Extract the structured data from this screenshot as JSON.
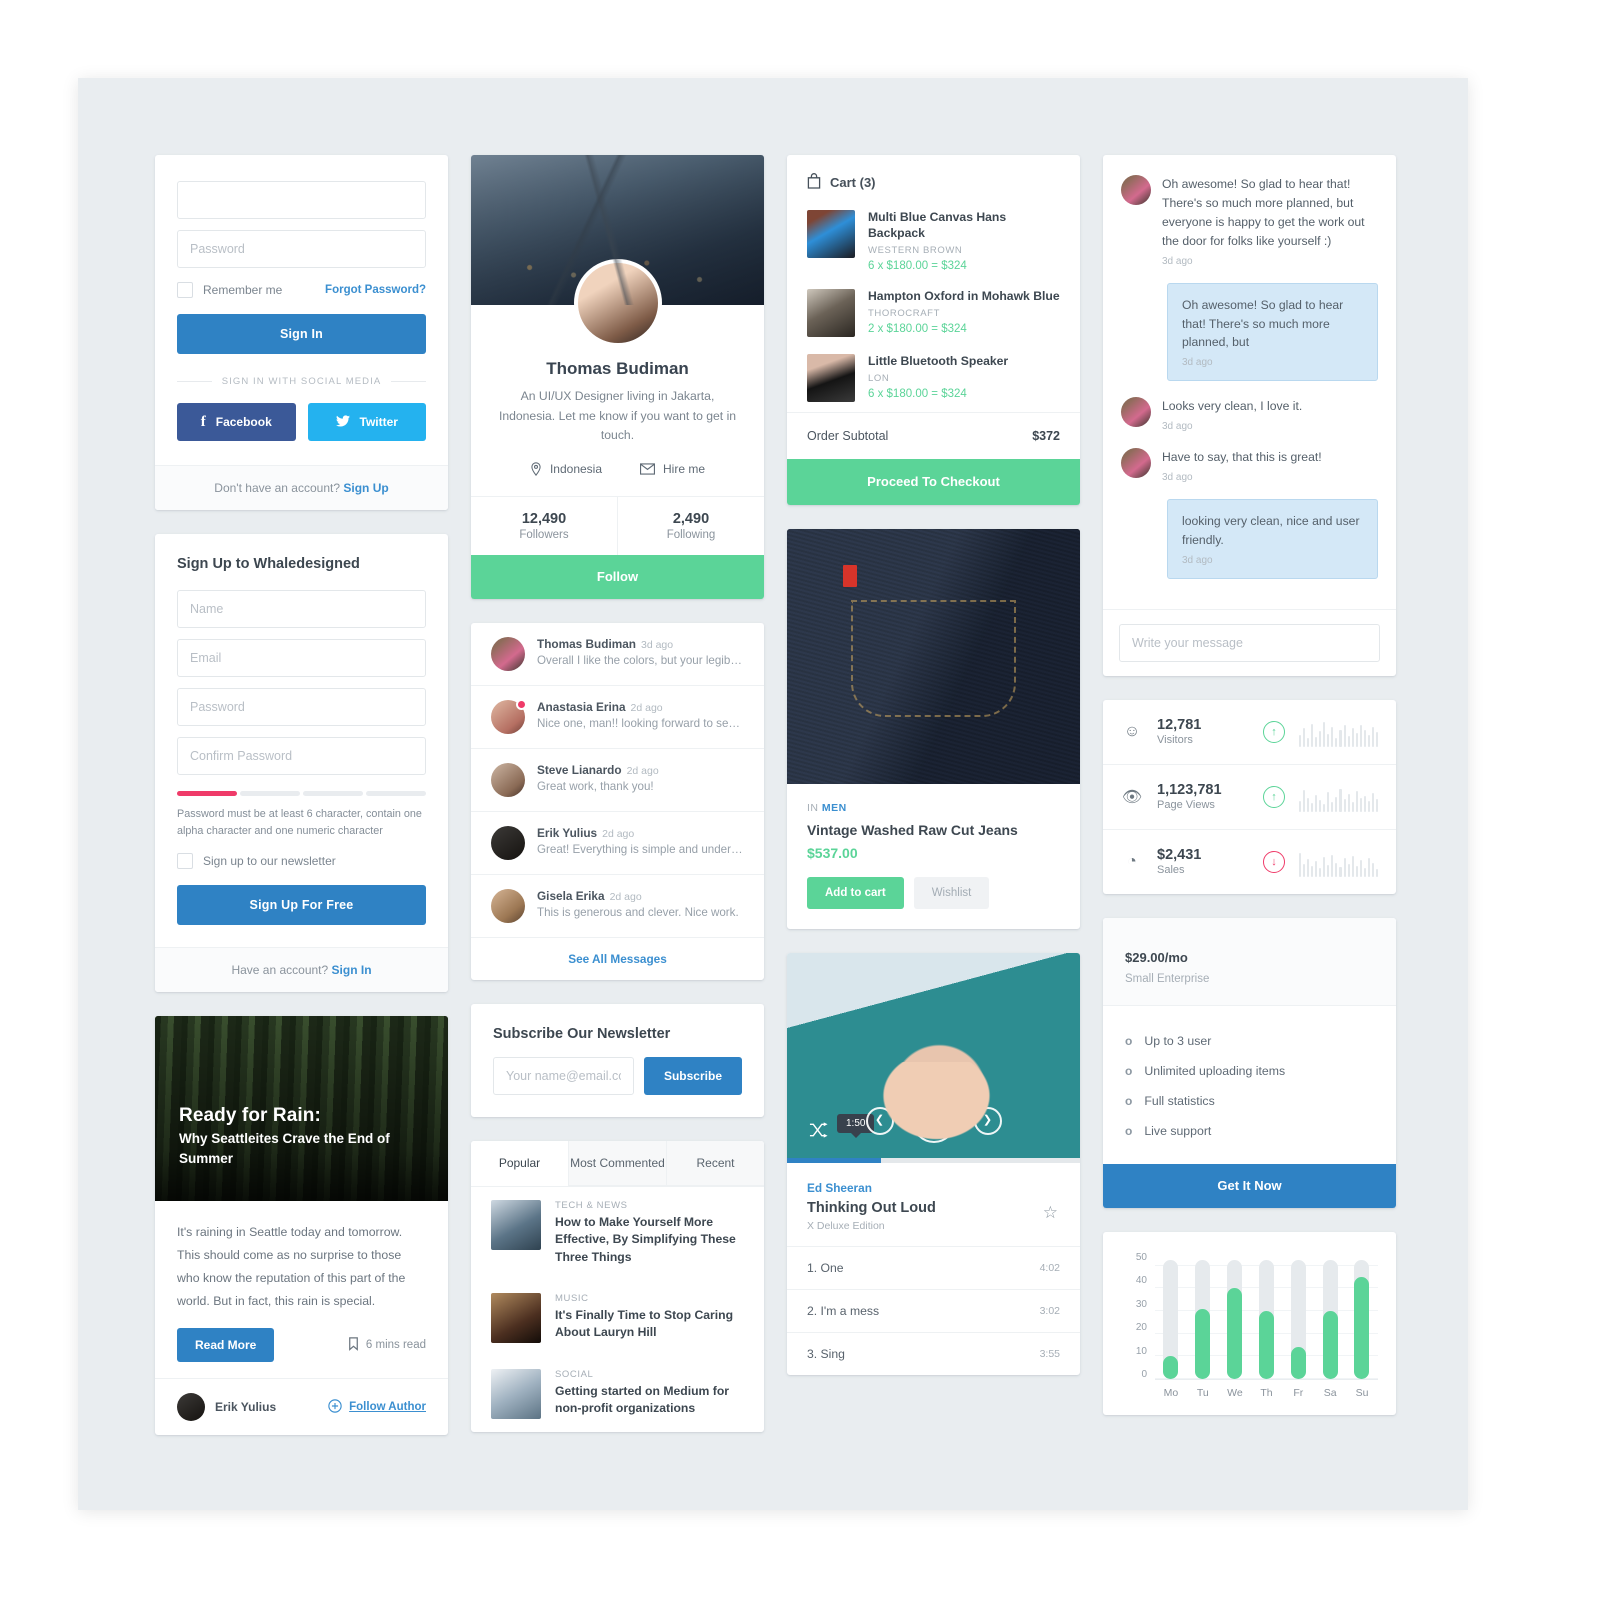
{
  "login": {
    "email_placeholder": "",
    "password_placeholder": "Password",
    "remember_label": "Remember me",
    "forgot_label": "Forgot Password?",
    "signin_label": "Sign In",
    "divider_label": "SIGN IN WITH  SOCIAL MEDIA",
    "facebook_label": "Facebook",
    "twitter_label": "Twitter",
    "footer_text": "Don't have an account?",
    "footer_link": "Sign Up"
  },
  "signup": {
    "title": "Sign Up to Whaledesigned",
    "name_placeholder": "Name",
    "email_placeholder": "Email",
    "password_placeholder": "Password",
    "confirm_placeholder": "Confirm Password",
    "strength_filled": 1,
    "strength_total": 4,
    "strength_color": "#ef3b69",
    "hint": "Password must be at least 6 character, contain one alpha character and one numeric character",
    "newsletter_label": "Sign up to our newsletter",
    "submit_label": "Sign Up For Free",
    "footer_text": "Have an account?",
    "footer_link": "Sign In"
  },
  "article": {
    "hero_title": "Ready for Rain:",
    "hero_subtitle": "Why Seattleites Crave the End of Summer",
    "body": "It's raining in Seattle today and tomorrow. This should come as no surprise to those who know the reputation of this part of the world. But in fact, this rain is special.",
    "read_more_label": "Read More",
    "read_time": "6 mins read",
    "author_name": "Erik Yulius",
    "follow_author_label": "Follow Author"
  },
  "profile": {
    "name": "Thomas Budiman",
    "bio": "An UI/UX Designer living in Jakarta, Indonesia. Let me know if you want to get in touch.",
    "location": "Indonesia",
    "hire": "Hire me",
    "followers_count": "12,490",
    "followers_label": "Followers",
    "following_count": "2,490",
    "following_label": "Following",
    "follow_label": "Follow"
  },
  "messages": {
    "items": [
      {
        "name": "Thomas Budiman",
        "time": "3d ago",
        "text": "Overall I like the colors, but your legibility...",
        "unread": false
      },
      {
        "name": "Anastasia Erina",
        "time": "2d ago",
        "text": "Nice one, man!! looking forward to seeing...",
        "unread": true
      },
      {
        "name": "Steve Lianardo",
        "time": "2d ago",
        "text": "Great work, thank you!",
        "unread": false
      },
      {
        "name": "Erik Yulius",
        "time": "2d ago",
        "text": "Great! Everything is simple and understood!",
        "unread": false
      },
      {
        "name": "Gisela Erika",
        "time": "2d ago",
        "text": "This is generous and clever. Nice work.",
        "unread": false
      }
    ],
    "see_all_label": "See All Messages"
  },
  "newsletter": {
    "title": "Subscribe Our Newsletter",
    "email_placeholder": "Your name@email.com",
    "subscribe_label": "Subscribe"
  },
  "posts": {
    "tabs": [
      "Popular",
      "Most Commented",
      "Recent"
    ],
    "active_tab": "Popular",
    "items": [
      {
        "category": "TECH & NEWS",
        "title": "How to Make Yourself More Effective, By Simplifying These Three Things"
      },
      {
        "category": "MUSIC",
        "title": "It's Finally Time to Stop Caring About Lauryn Hill"
      },
      {
        "category": "SOCIAL",
        "title": "Getting started on Medium for non-profit organizations"
      }
    ]
  },
  "cart": {
    "title": "Cart (3)",
    "items": [
      {
        "name": "Multi Blue Canvas Hans Backpack",
        "brand": "WESTERN BROWN",
        "price": "6 x $180.00 = $324"
      },
      {
        "name": "Hampton Oxford in Mohawk Blue",
        "brand": "THOROCRAFT",
        "price": "2 x $180.00 = $324"
      },
      {
        "name": "Little Bluetooth Speaker",
        "brand": "LON",
        "price": "6 x $180.00 = $324"
      }
    ],
    "subtotal_label": "Order Subtotal",
    "subtotal_value": "$372",
    "checkout_label": "Proceed To Checkout"
  },
  "product": {
    "category_prefix": "IN",
    "category": "MEN",
    "name": "Vintage Washed Raw Cut Jeans",
    "price": "$537.00",
    "add_label": "Add to cart",
    "wishlist_label": "Wishlist"
  },
  "music": {
    "time_badge": "1:50",
    "artist": "Ed Sheeran",
    "title": "Thinking Out Loud",
    "album": "X Deluxe Edition",
    "tracks": [
      {
        "name": "1. One",
        "duration": "4:02"
      },
      {
        "name": "2. I'm a mess",
        "duration": "3:02"
      },
      {
        "name": "3. Sing",
        "duration": "3:55"
      }
    ]
  },
  "chat": {
    "messages": [
      {
        "side": "left",
        "text": "Oh awesome! So glad to hear that! There's so much more planned, but everyone is happy to get the work out the door for folks like yourself :)",
        "time": "3d ago"
      },
      {
        "side": "right",
        "text": "Oh awesome! So glad to hear that! There's so much more planned, but",
        "time": "3d ago"
      },
      {
        "side": "left",
        "text": "Looks very clean, I love it.",
        "time": "3d ago"
      },
      {
        "side": "left",
        "text": "Have to say, that this is great!",
        "time": "3d ago"
      },
      {
        "side": "right",
        "text": "looking very clean, nice and user friendly.",
        "time": "3d ago"
      }
    ],
    "input_placeholder": "Write your message"
  },
  "analytics": {
    "rows": [
      {
        "icon": "smiley-icon",
        "value": "12,781",
        "label": "Visitors",
        "trend": "up",
        "spark": [
          40,
          62,
          30,
          78,
          34,
          52,
          84,
          44,
          66,
          30,
          56,
          72,
          38,
          62,
          46,
          74,
          56,
          40,
          68,
          50
        ]
      },
      {
        "icon": "eye-icon",
        "value": "1,123,781",
        "label": "Page Views",
        "trend": "up",
        "spark": [
          36,
          72,
          48,
          30,
          58,
          40,
          26,
          66,
          34,
          50,
          78,
          42,
          60,
          32,
          70,
          46,
          54,
          38,
          64,
          44
        ]
      },
      {
        "icon": "pie-chart-icon",
        "value": "$2,431",
        "label": "Sales",
        "trend": "down",
        "spark": [
          80,
          44,
          60,
          36,
          52,
          30,
          66,
          40,
          74,
          48,
          34,
          62,
          42,
          70,
          38,
          56,
          30,
          64,
          46,
          28
        ]
      }
    ]
  },
  "pricing": {
    "price": "$29.00",
    "period": "/mo",
    "plan": "Small Enterprise",
    "features": [
      "Up to 3 user",
      "Unlimited uploading items",
      "Full statistics",
      "Live support"
    ],
    "cta_label": "Get It Now"
  },
  "chart_data": {
    "type": "bar",
    "categories": [
      "Mo",
      "Tu",
      "We",
      "Th",
      "Fr",
      "Sa",
      "Su"
    ],
    "values": [
      10,
      31,
      40,
      30,
      14,
      30,
      45
    ],
    "track_max": 56,
    "title": "",
    "xlabel": "",
    "ylabel": "",
    "ylim": [
      0,
      50
    ],
    "yticks": [
      50,
      40,
      30,
      20,
      10,
      0
    ],
    "grid": true,
    "bar_color": "#5bd498",
    "track_color": "#e6eaed"
  }
}
